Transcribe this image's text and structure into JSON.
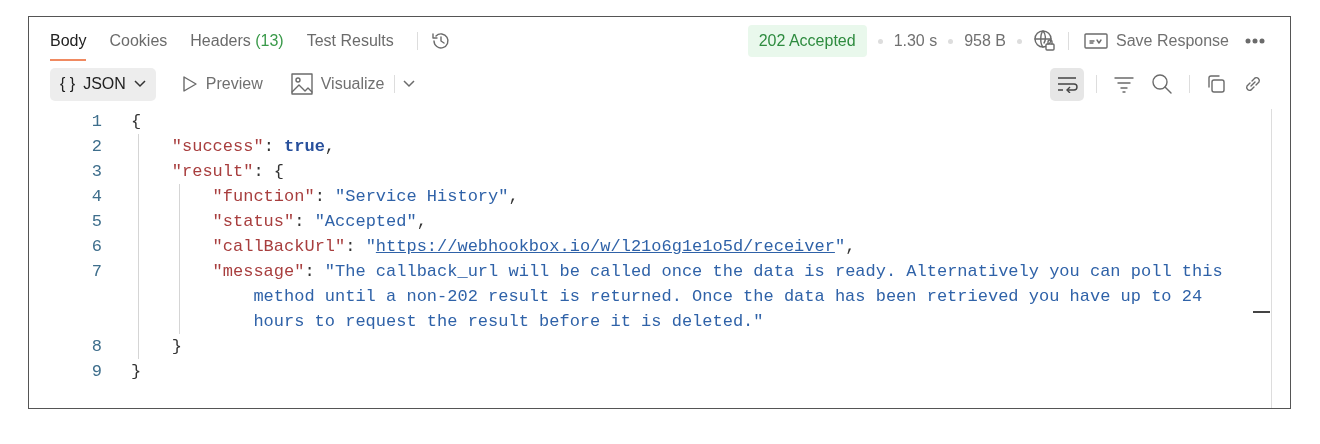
{
  "response_tabs": [
    {
      "label": "Body",
      "selected": true
    },
    {
      "label": "Cookies",
      "selected": false
    },
    {
      "label": "Headers",
      "count": "(13)",
      "selected": false
    },
    {
      "label": "Test Results",
      "selected": false
    }
  ],
  "status": {
    "code": "202 Accepted",
    "time": "1.30 s",
    "size": "958 B"
  },
  "save_button": {
    "label": "Save Response"
  },
  "view_toolbar": {
    "format_icon": "{ }",
    "format": "JSON",
    "modes": [
      {
        "label": "Preview",
        "kind": "preview"
      },
      {
        "label": "Visualize",
        "kind": "visualize"
      }
    ]
  },
  "word_wrap": {
    "on": true
  },
  "code": {
    "lines": [
      {
        "number": "1",
        "tokens": [
          {
            "kind": "punct",
            "text": "{"
          }
        ],
        "children": [
          {
            "number": "2",
            "tokens": [
              {
                "kind": "key",
                "text": "\"success\""
              },
              {
                "kind": "punct",
                "text": ": "
              },
              {
                "kind": "boolean",
                "text": "true"
              },
              {
                "kind": "punct",
                "text": ","
              }
            ]
          },
          {
            "number": "3",
            "tokens": [
              {
                "kind": "key",
                "text": "\"result\""
              },
              {
                "kind": "punct",
                "text": ": {"
              }
            ],
            "children": [
              {
                "number": "4",
                "tokens": [
                  {
                    "kind": "key",
                    "text": "\"function\""
                  },
                  {
                    "kind": "punct",
                    "text": ": "
                  },
                  {
                    "kind": "string",
                    "text": "\"Service History\""
                  },
                  {
                    "kind": "punct",
                    "text": ","
                  }
                ]
              },
              {
                "number": "5",
                "tokens": [
                  {
                    "kind": "key",
                    "text": "\"status\""
                  },
                  {
                    "kind": "punct",
                    "text": ": "
                  },
                  {
                    "kind": "string",
                    "text": "\"Accepted\""
                  },
                  {
                    "kind": "punct",
                    "text": ","
                  }
                ]
              },
              {
                "number": "6",
                "tokens": [
                  {
                    "kind": "key",
                    "text": "\"callBackUrl\""
                  },
                  {
                    "kind": "punct",
                    "text": ": "
                  },
                  {
                    "kind": "string",
                    "text": "\""
                  },
                  {
                    "kind": "link",
                    "text": "https://webhookbox.io/w/l21o6g1e1o5d/receiver"
                  },
                  {
                    "kind": "string",
                    "text": "\""
                  },
                  {
                    "kind": "punct",
                    "text": ","
                  }
                ]
              },
              {
                "number": "7",
                "tokens": [
                  {
                    "kind": "key",
                    "text": "\"message\""
                  },
                  {
                    "kind": "punct",
                    "text": ": "
                  },
                  {
                    "kind": "string",
                    "lines": [
                      "\"The callback_url will be called once the data is ready. Alternatively you can poll this",
                      "method until a non-202 result is returned. Once the data has been retrieved you have up to 24",
                      "hours to request the result before it is deleted.\""
                    ]
                  }
                ]
              }
            ]
          },
          {
            "number": "8",
            "tokens": [
              {
                "kind": "punct",
                "text": "}"
              }
            ]
          }
        ]
      },
      {
        "number": "9",
        "tokens": [
          {
            "kind": "punct",
            "text": "}"
          }
        ]
      }
    ]
  }
}
